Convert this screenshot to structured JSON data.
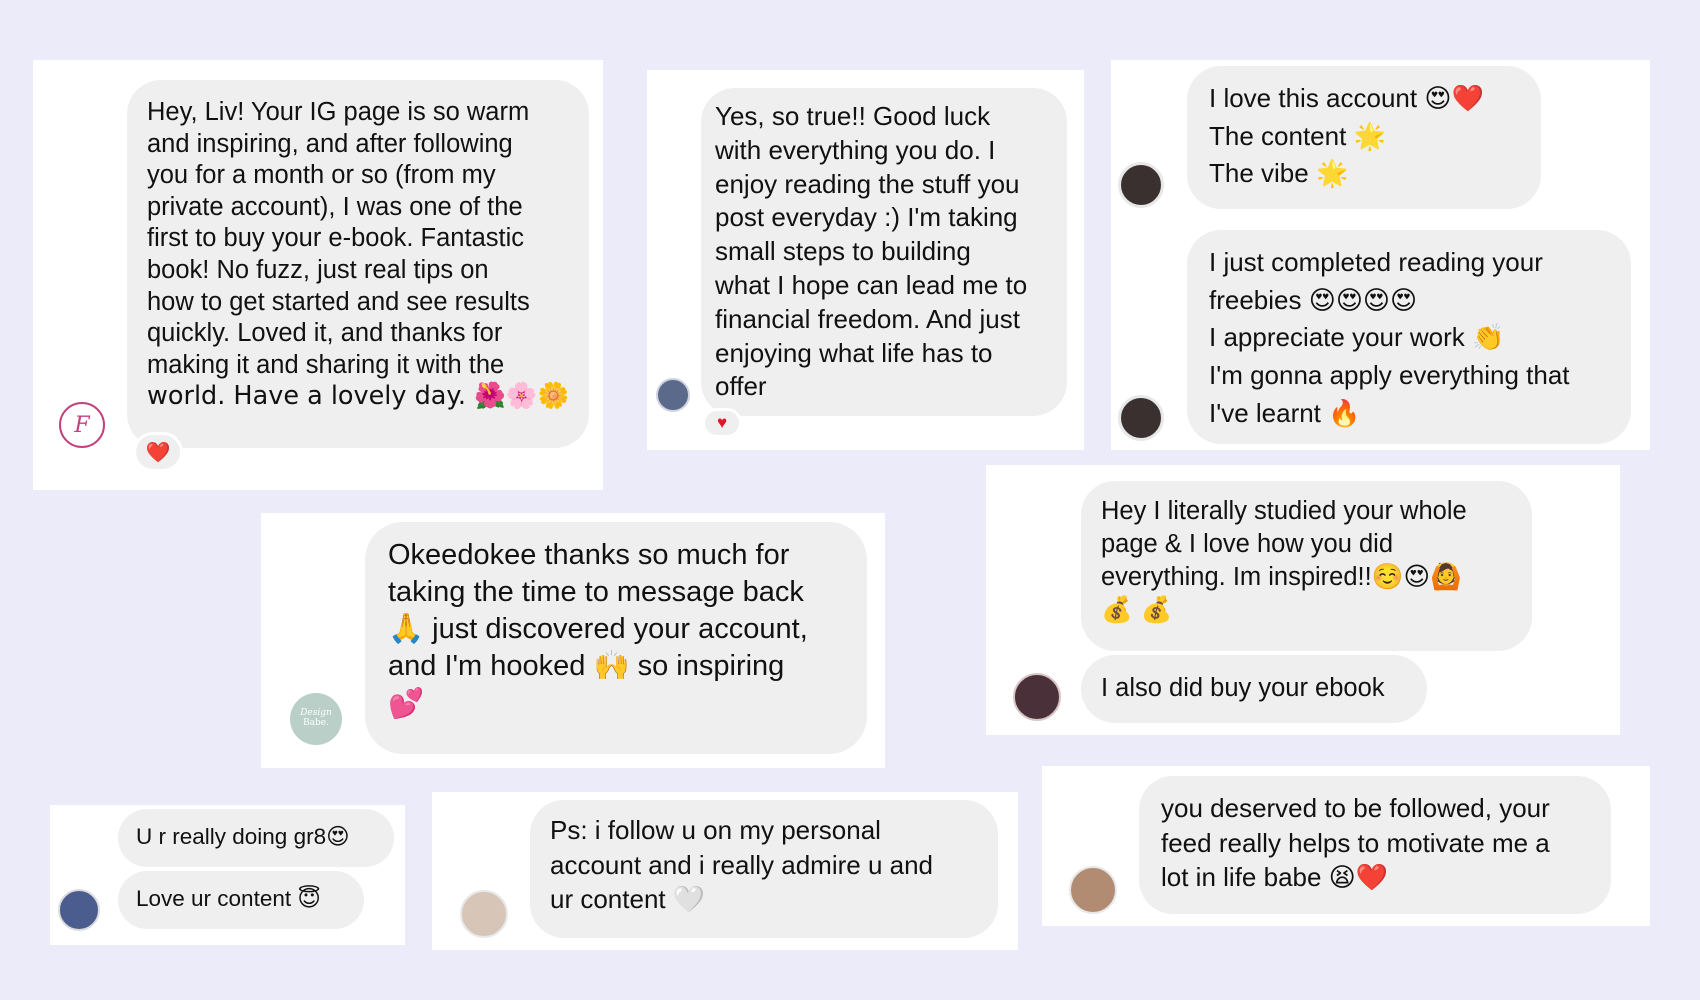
{
  "messages": {
    "m1": {
      "lines": [
        "Hey, Liv! Your IG page is so warm",
        "and inspiring, and after following",
        "you for a month or so (from my",
        "private account), I was one of the",
        "first to buy your e-book. Fantastic",
        "book! No fuzz, just real tips on",
        "how to get started and see results",
        "quickly. Loved it, and thanks for",
        "making it and sharing it with the",
        "world. Have a lovely day. 🌺🌸🌼"
      ],
      "reaction": "❤️",
      "avatar_letter": "F"
    },
    "m2": {
      "lines": [
        "Yes, so true!! Good luck",
        "with everything you do. I",
        "enjoy reading the stuff you",
        "post everyday :) I'm taking",
        "small steps to building",
        "what I hope can lead me to",
        "financial freedom. And just",
        "enjoying what life has to",
        "offer"
      ],
      "reaction": "♥"
    },
    "m3a": {
      "lines": [
        "I love this account 😍❤️",
        "The content 🌟",
        "The vibe 🌟"
      ]
    },
    "m3b": {
      "lines": [
        "I just completed reading your",
        "freebies 😍😍😍😍",
        "I appreciate your work 👏",
        "I'm gonna apply everything that",
        "I've learnt 🔥"
      ]
    },
    "m4": {
      "lines": [
        "Okeedokee thanks so much for",
        "taking the time to message back",
        "🙏 just discovered your account,",
        "and I'm hooked 🙌 so inspiring",
        "💕"
      ],
      "avatar_text": [
        "Design",
        "Babe."
      ]
    },
    "m5a": {
      "lines": [
        "Hey I literally studied your whole",
        "page & I love how you did",
        "everything. Im inspired!!☺️😍🙆",
        "💰 💰"
      ]
    },
    "m5b": {
      "lines": [
        "I also did buy your ebook"
      ]
    },
    "m6a": {
      "lines": [
        "U r really doing gr8😍"
      ]
    },
    "m6b": {
      "lines": [
        "Love ur content 😇"
      ]
    },
    "m7": {
      "lines": [
        "Ps: i follow u on my personal",
        "account and i really admire u and",
        "ur content 🤍"
      ]
    },
    "m8": {
      "lines": [
        "you deserved to be followed, your",
        "feed really helps to motivate me a",
        "lot in life babe 😫❤️"
      ]
    }
  },
  "colors": {
    "page_background": "#ecebf9",
    "card_background": "#ffffff",
    "bubble_background": "#efefef",
    "text": "#111111",
    "heart": "#e0152a"
  }
}
